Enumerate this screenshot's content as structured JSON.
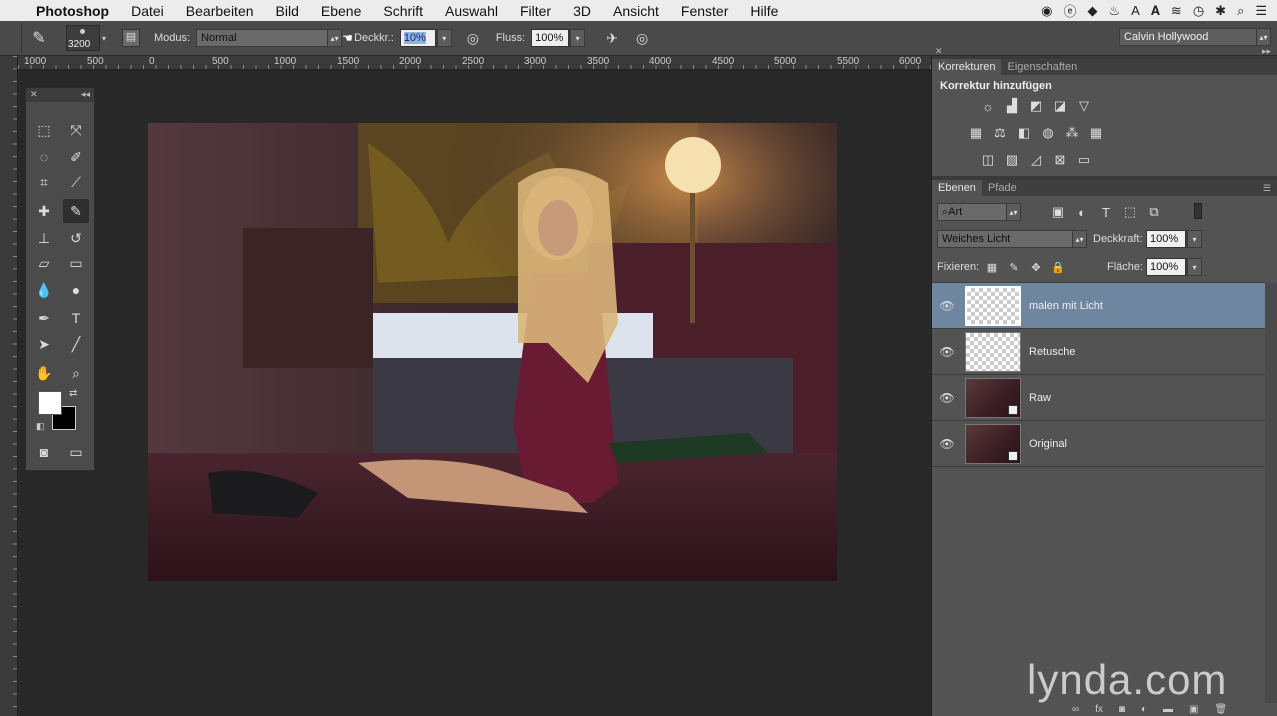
{
  "menubar": {
    "app_name": "Photoshop",
    "items": [
      "Datei",
      "Bearbeiten",
      "Bild",
      "Ebene",
      "Schrift",
      "Auswahl",
      "Filter",
      "3D",
      "Ansicht",
      "Fenster",
      "Hilfe"
    ]
  },
  "options": {
    "brush_size": "3200",
    "mode_label": "Modus:",
    "mode_value": "Normal",
    "opacity_label": "Deckkr.:",
    "opacity_value": "10%",
    "flow_label": "Fluss:",
    "flow_value": "100%",
    "workspace": "Calvin Hollywood"
  },
  "ruler": {
    "labels": [
      "1000",
      "500",
      "0",
      "500",
      "1000",
      "1500",
      "2000",
      "2500",
      "3000",
      "3500",
      "4000",
      "4500",
      "5000",
      "5500",
      "6000"
    ]
  },
  "panels": {
    "adjust_tab": "Korrekturen",
    "props_tab": "Eigenschaften",
    "adjust_title": "Korrektur hinzufügen",
    "layers_tab": "Ebenen",
    "paths_tab": "Pfade",
    "filter_kind": "Art",
    "blend_mode": "Weiches Licht",
    "opacity_label": "Deckkraft:",
    "opacity_value": "100%",
    "lock_label": "Fixieren:",
    "fill_label": "Fläche:",
    "fill_value": "100%"
  },
  "layers": [
    {
      "name": "malen mit Licht",
      "selected": true,
      "type": "empty"
    },
    {
      "name": "Retusche",
      "selected": false,
      "type": "empty"
    },
    {
      "name": "Raw",
      "selected": false,
      "type": "photo"
    },
    {
      "name": "Original",
      "selected": false,
      "type": "photo"
    }
  ],
  "watermark": "lynda.com",
  "colors": {
    "ui_dark": "#282828",
    "panel": "#535353",
    "selected_layer": "#6e86a0",
    "foreground": "#ffffff",
    "background_swatch": "#000000"
  }
}
